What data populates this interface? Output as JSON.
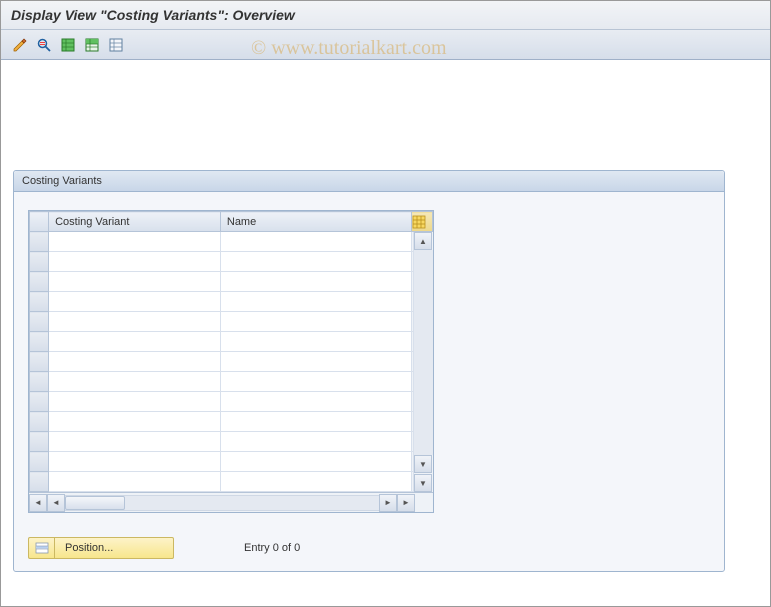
{
  "header": {
    "title": "Display View \"Costing Variants\": Overview"
  },
  "toolbar": {
    "icons": [
      "change-icon",
      "view-details-icon",
      "select-all-icon",
      "select-block-icon",
      "deselect-all-icon"
    ]
  },
  "watermark": "© www.tutorialkart.com",
  "groupbox": {
    "title": "Costing Variants",
    "columns": {
      "col1": "Costing Variant",
      "col2": "Name"
    },
    "row_count": 13
  },
  "footer": {
    "position_label": "Position...",
    "entry_status": "Entry 0 of 0"
  }
}
